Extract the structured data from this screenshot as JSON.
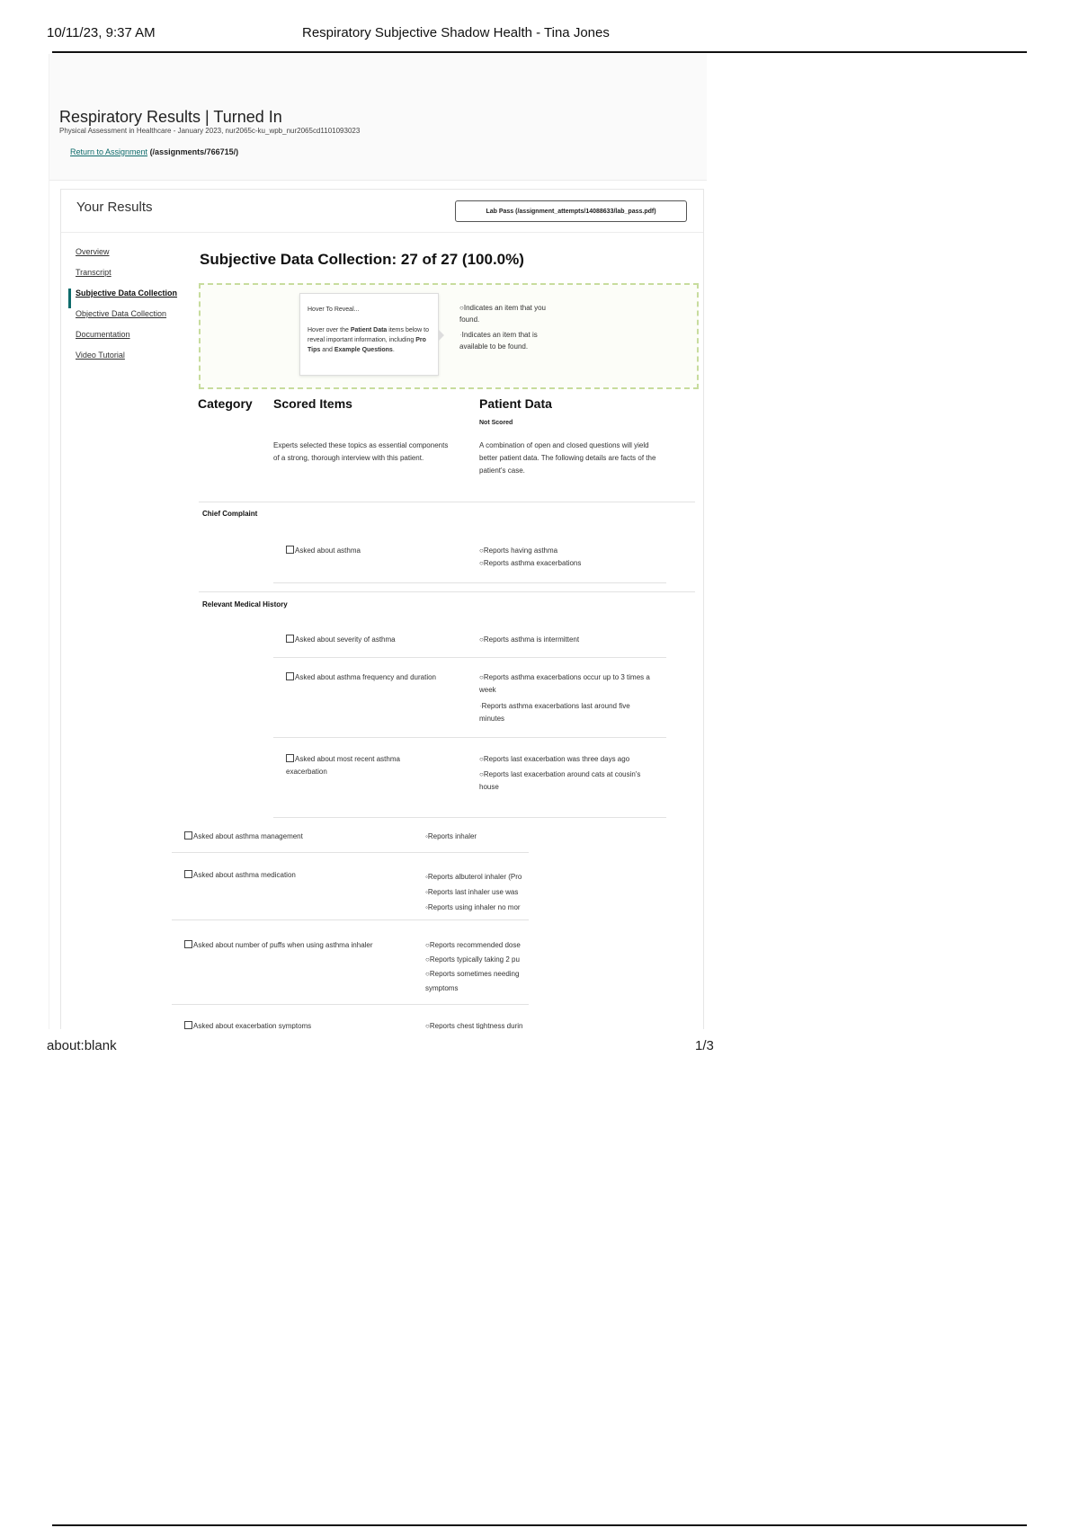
{
  "print_header": {
    "date": "10/11/23, 9:37 AM",
    "title": "Respiratory Subjective Shadow Health - Tina Jones"
  },
  "print_footer": {
    "url": "about:blank",
    "page": "1/3"
  },
  "page": {
    "title": "Respiratory Results | Turned In",
    "course": "Physical Assessment in Healthcare - January 2023, nur2065c-ku_wpb_nur2065cd1101093023",
    "return_link": "Return to Assignment",
    "return_path": "(/assignments/766715/)"
  },
  "results": {
    "heading": "Your Results",
    "lab_pass": "Lab Pass (/assignment_attempts/14088633/lab_pass.pdf)"
  },
  "nav": {
    "items": [
      {
        "label": "Overview"
      },
      {
        "label": "Transcript"
      },
      {
        "label": "Subjective Data Collection"
      },
      {
        "label": "Objective Data Collection"
      },
      {
        "label": "Documentation"
      },
      {
        "label": "Video Tutorial"
      }
    ]
  },
  "section": {
    "title": "Subjective Data Collection: 27 of 27 (100.0%)"
  },
  "legend": {
    "hover_title": "Hover To Reveal...",
    "hover_body_1": "Hover over the ",
    "hover_bold_1": "Patient Data",
    "hover_body_2": " items below to reveal important information, including ",
    "hover_bold_2": "Pro Tips",
    "hover_body_3": " and ",
    "hover_bold_3": "Example Questions",
    "hover_body_4": ".",
    "found": "Indicates an item that you found.",
    "available": "Indicates an item that is available to be found."
  },
  "table": {
    "col_category": "Category",
    "col_scored": "Scored Items",
    "col_patient": "Patient Data",
    "not_scored": "Not Scored",
    "scored_desc": "Experts selected these topics as essential components of a strong, thorough interview with this patient.",
    "patient_desc": "A combination of open and closed questions will yield better patient data. The following details are facts of the patient's case.",
    "categories": {
      "chief_complaint": "Chief Complaint",
      "relevant_history": "Relevant Medical History"
    },
    "rows": [
      {
        "item": "Asked about asthma",
        "data": [
          "Reports having asthma",
          "Reports asthma exacerbations"
        ]
      },
      {
        "item": "Asked about severity of asthma",
        "data": [
          "Reports asthma is intermittent"
        ]
      },
      {
        "item": "Asked about asthma frequency and duration",
        "data": [
          "Reports asthma exacerbations occur up to 3 times a week",
          "Reports asthma exacerbations last around five minutes"
        ]
      },
      {
        "item": "Asked about most recent asthma exacerbation",
        "data": [
          "Reports last exacerbation was three days ago",
          "Reports last exacerbation around cats at cousin's house"
        ]
      },
      {
        "item": "Asked about asthma management",
        "data": [
          "Reports inhaler"
        ]
      },
      {
        "item": "Asked about asthma medication",
        "data": [
          "Reports albuterol inhaler (Pro",
          "Reports last inhaler use was",
          "Reports using inhaler no mor"
        ]
      },
      {
        "item": "Asked about number of puffs when using asthma inhaler",
        "data": [
          "Reports recommended dose",
          "Reports typically taking 2 pu",
          "Reports sometimes needing",
          "symptoms"
        ]
      },
      {
        "item": "Asked about exacerbation symptoms",
        "data": [
          "Reports chest tightness durin"
        ]
      }
    ]
  }
}
